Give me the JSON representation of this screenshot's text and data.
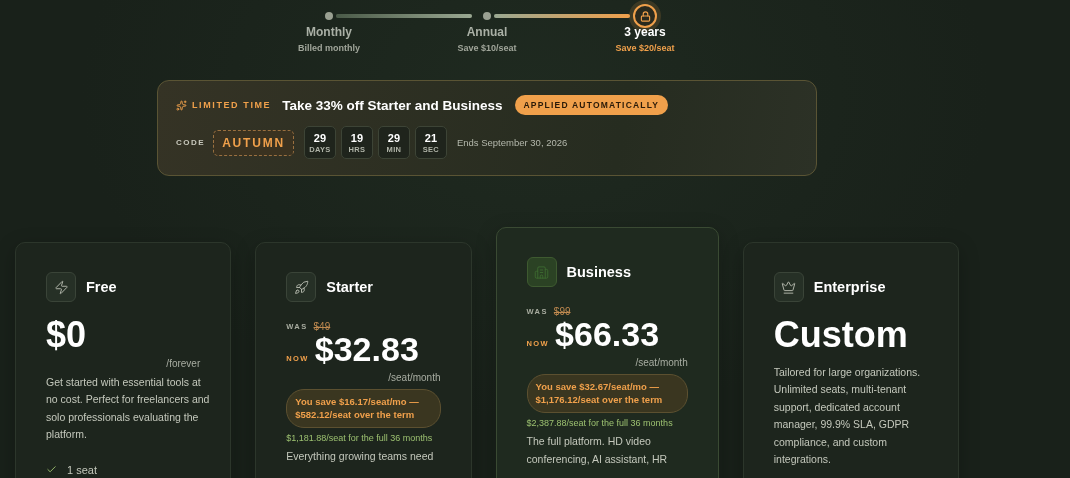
{
  "billing": {
    "options": [
      {
        "label": "Monthly",
        "note": "Billed monthly",
        "selected": false
      },
      {
        "label": "Annual",
        "note": "Save $10/seat",
        "selected": false
      },
      {
        "label": "3 years",
        "note": "Save $20/seat",
        "selected": true
      }
    ]
  },
  "promo": {
    "tag": "LIMITED TIME",
    "headline": "Take 33% off Starter and Business",
    "badge": "APPLIED AUTOMATICALLY",
    "code_label": "CODE",
    "code": "AUTUMN",
    "countdown": [
      {
        "value": "29",
        "unit": "DAYS"
      },
      {
        "value": "19",
        "unit": "HRS"
      },
      {
        "value": "29",
        "unit": "MIN"
      },
      {
        "value": "21",
        "unit": "SEC"
      }
    ],
    "ends": "Ends September 30, 2026"
  },
  "plans": [
    {
      "name": "Free",
      "featured": false,
      "price": "$0",
      "period": "/forever",
      "description": "Get started with essential tools at no cost. Perfect for freelancers and solo professionals evaluating the platform.",
      "features": [
        "1 seat"
      ]
    },
    {
      "name": "Starter",
      "featured": false,
      "was_label": "WAS",
      "was_price": "$49",
      "now_label": "NOW",
      "price": "$32.83",
      "period": "/seat/month",
      "savings": "You save $16.17/seat/mo — $582.12/seat over the term",
      "total": "$1,181.88/seat for the full 36 months",
      "description": "Everything growing teams need"
    },
    {
      "name": "Business",
      "featured": true,
      "was_label": "WAS",
      "was_price": "$99",
      "now_label": "NOW",
      "price": "$66.33",
      "period": "/seat/month",
      "savings": "You save $32.67/seat/mo — $1,176.12/seat over the term",
      "total": "$2,387.88/seat for the full 36 months",
      "description": "The full platform. HD video conferencing, AI assistant, HR"
    },
    {
      "name": "Enterprise",
      "featured": false,
      "price": "Custom",
      "description": "Tailored for large organizations. Unlimited seats, multi-tenant support, dedicated account manager, 99.9% SLA, GDPR compliance, and custom integrations."
    }
  ]
}
